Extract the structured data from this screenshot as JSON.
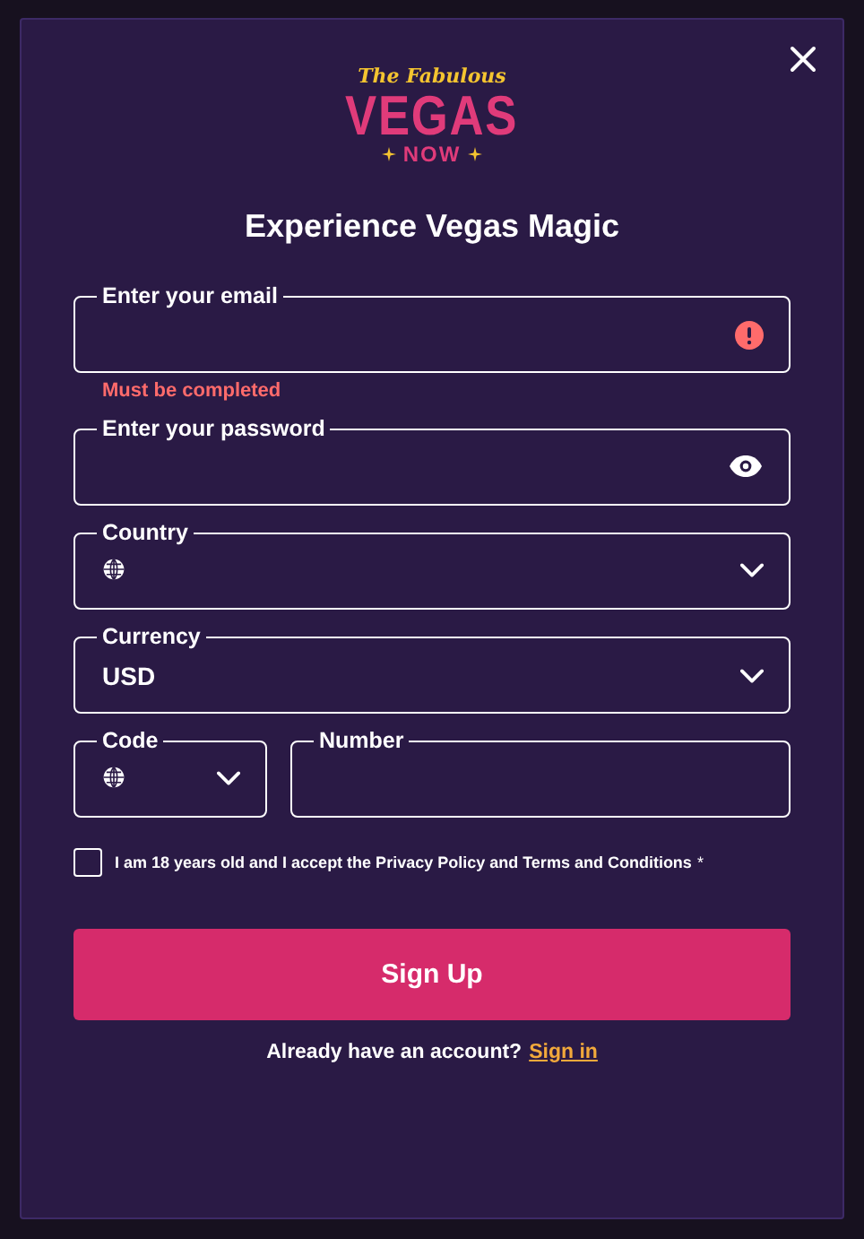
{
  "logo": {
    "top": "The Fabulous",
    "main": "VEGAS",
    "bottom": "NOW"
  },
  "title": "Experience Vegas Magic",
  "rows": [
    [
      {
        "label": "Enter your email",
        "kind": "text",
        "error": "Must be completed"
      }
    ],
    [
      {
        "label": "Enter your password",
        "kind": "password"
      }
    ],
    [
      {
        "label": "Country",
        "kind": "select",
        "globe": true
      }
    ],
    [
      {
        "label": "Currency",
        "kind": "select",
        "value": "USD"
      }
    ],
    [
      {
        "label": "Code",
        "kind": "select",
        "globe": true,
        "narrow": true
      },
      {
        "label": "Number",
        "kind": "text"
      }
    ]
  ],
  "terms": {
    "checked": false,
    "text": "I am 18 years old and I accept the Privacy Policy and Terms and Conditions",
    "required": "*"
  },
  "button": "Sign Up",
  "footer": {
    "text": "Already have an account?",
    "link": "Sign in"
  }
}
